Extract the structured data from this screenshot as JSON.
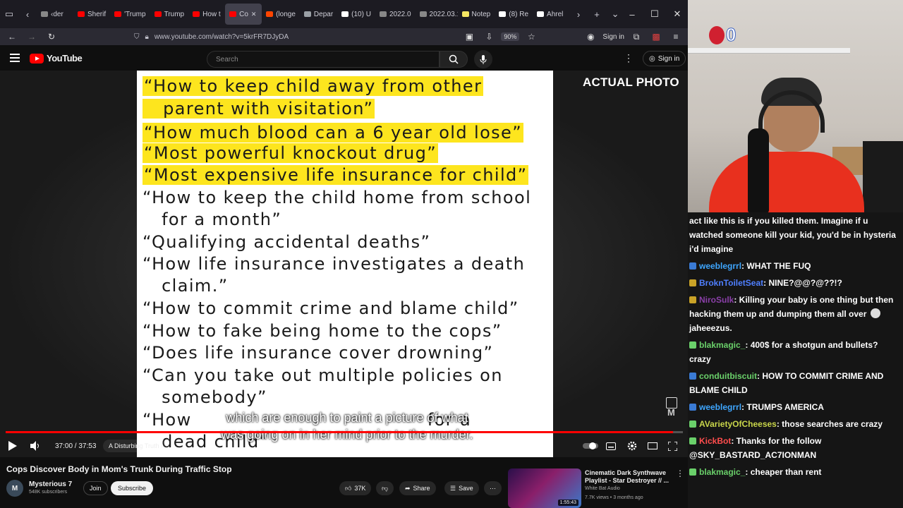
{
  "browser": {
    "tabs": [
      {
        "label": "‹der",
        "color": "#888888"
      },
      {
        "label": "Sherif",
        "color": "#ff0000"
      },
      {
        "label": "'Trump",
        "color": "#ff0000"
      },
      {
        "label": "Trump",
        "color": "#ff0000"
      },
      {
        "label": "How t",
        "color": "#ff0000"
      },
      {
        "label": "Co",
        "color": "#ff0000",
        "active": true
      },
      {
        "label": "(longe",
        "color": "#ff4500"
      },
      {
        "label": "Depar",
        "color": "#9aa0a6"
      },
      {
        "label": "(10) U",
        "color": "#ffffff"
      },
      {
        "label": "2022.0",
        "color": "#888888"
      },
      {
        "label": "2022.03.1",
        "color": "#888888"
      },
      {
        "label": "Notep",
        "color": "#f5e663"
      },
      {
        "label": "(8) Re",
        "color": "#ffffff"
      },
      {
        "label": "Ahrel",
        "color": "#ffffff"
      }
    ],
    "url": "www.youtube.com/watch?v=5krFR7DJyDA",
    "zoom": "90%",
    "signin": "Sign in"
  },
  "youtube": {
    "logo_text": "YouTube",
    "search_placeholder": "Search",
    "signin": "Sign in"
  },
  "player": {
    "slide_lines": [
      {
        "text": "“How to keep child away from other",
        "hl": true
      },
      {
        "text": "   parent with visitation”",
        "hl": true
      },
      {
        "text": "“How much blood can a 6 year old lose”",
        "hl": true
      },
      {
        "text": "“Most powerful knockout drug”",
        "hl": true
      },
      {
        "text": "“Most expensive life insurance for child”",
        "hl": true
      },
      {
        "text": "“How to keep the child home from school",
        "hl": false
      },
      {
        "text": "   for a month”",
        "hl": false
      },
      {
        "text": "“Qualifying accidental deaths”",
        "hl": false
      },
      {
        "text": "“How life insurance investigates a death",
        "hl": false
      },
      {
        "text": "   claim.”",
        "hl": false
      },
      {
        "text": "“How to commit crime and blame child”",
        "hl": false
      },
      {
        "text": "“How to fake being home to the cops”",
        "hl": false
      },
      {
        "text": "“Does life insurance cover drowning”",
        "hl": false
      },
      {
        "text": "“Can you take out multiple policies on",
        "hl": false
      },
      {
        "text": "   somebody”",
        "hl": false
      },
      {
        "text": "“How                                     for a",
        "hl": false
      },
      {
        "text": "   dead child”",
        "hl": false
      }
    ],
    "overlay_label": "ACTUAL PHOTO",
    "caption_line1": "which are enough to paint a picture of what",
    "caption_line2": "was going on in her mind prior to the murder.",
    "watermark": "M",
    "progress_fraction": 0.985,
    "time": "37:00 / 37:53",
    "chapter": "A Disturbing Truth ›"
  },
  "video": {
    "title": "Cops Discover Body in Mom's Trunk During Traffic Stop",
    "channel": "Mysterious 7",
    "channel_initial": "M",
    "subscribers": "548K subscribers",
    "join": "Join",
    "subscribe": "Subscribe",
    "likes": "37K",
    "share": "Share",
    "save": "Save"
  },
  "recommended": {
    "title": "Cinematic Dark Synthwave Playlist - Star Destroyer // ...",
    "channel": "White Bat Audio",
    "meta": "7.7K views • 3 months ago",
    "duration": "1:55:43"
  },
  "stream": {
    "counter": "0"
  },
  "chat": [
    {
      "user": "",
      "color": "#ffffff",
      "text": "act like this is if you killed them. Imagine if u watched someone kill your kid, you'd be in hysteria i'd imagine",
      "badge": ""
    },
    {
      "user": "weeblegrrl",
      "color": "#3ea6ff",
      "text": ": WHAT THE FUQ",
      "badge": "#3a7bd5"
    },
    {
      "user": "BroknToiletSeat",
      "color": "#4f7fff",
      "text": ": NINE?@@?@??!?",
      "badge": "#c9a227"
    },
    {
      "user": "NiroSulk",
      "color": "#8a3fa8",
      "text": ": Killing your baby is one thing but then hacking them up and dumping them all over",
      "badge": "#c9a227",
      "emote_text": "jaheeezus."
    },
    {
      "user": "blakmagic_",
      "color": "#6ad06a",
      "text": ": 400$ for a shotgun and bullets? crazy",
      "badge": "#6ad06a"
    },
    {
      "user": "conduitbiscuit",
      "color": "#6ad06a",
      "text": ": HOW TO COMMIT CRIME AND BLAME CHILD",
      "badge": "#3a7bd5"
    },
    {
      "user": "weeblegrrl",
      "color": "#3ea6ff",
      "text": ": TRUMPS AMERICA",
      "badge": "#3a7bd5"
    },
    {
      "user": "AVarietyOfCheeses",
      "color": "#c9d64a",
      "text": ": those searches are crazy",
      "badge": "#6ad06a"
    },
    {
      "user": "KickBot",
      "color": "#ff4d4d",
      "text": ": Thanks for the follow @SKY_BASTARD_AC7IONMAN",
      "badge": "#6ad06a"
    },
    {
      "user": "blakmagic_",
      "color": "#6ad06a",
      "text": ": cheaper than rent",
      "badge": "#6ad06a"
    }
  ]
}
